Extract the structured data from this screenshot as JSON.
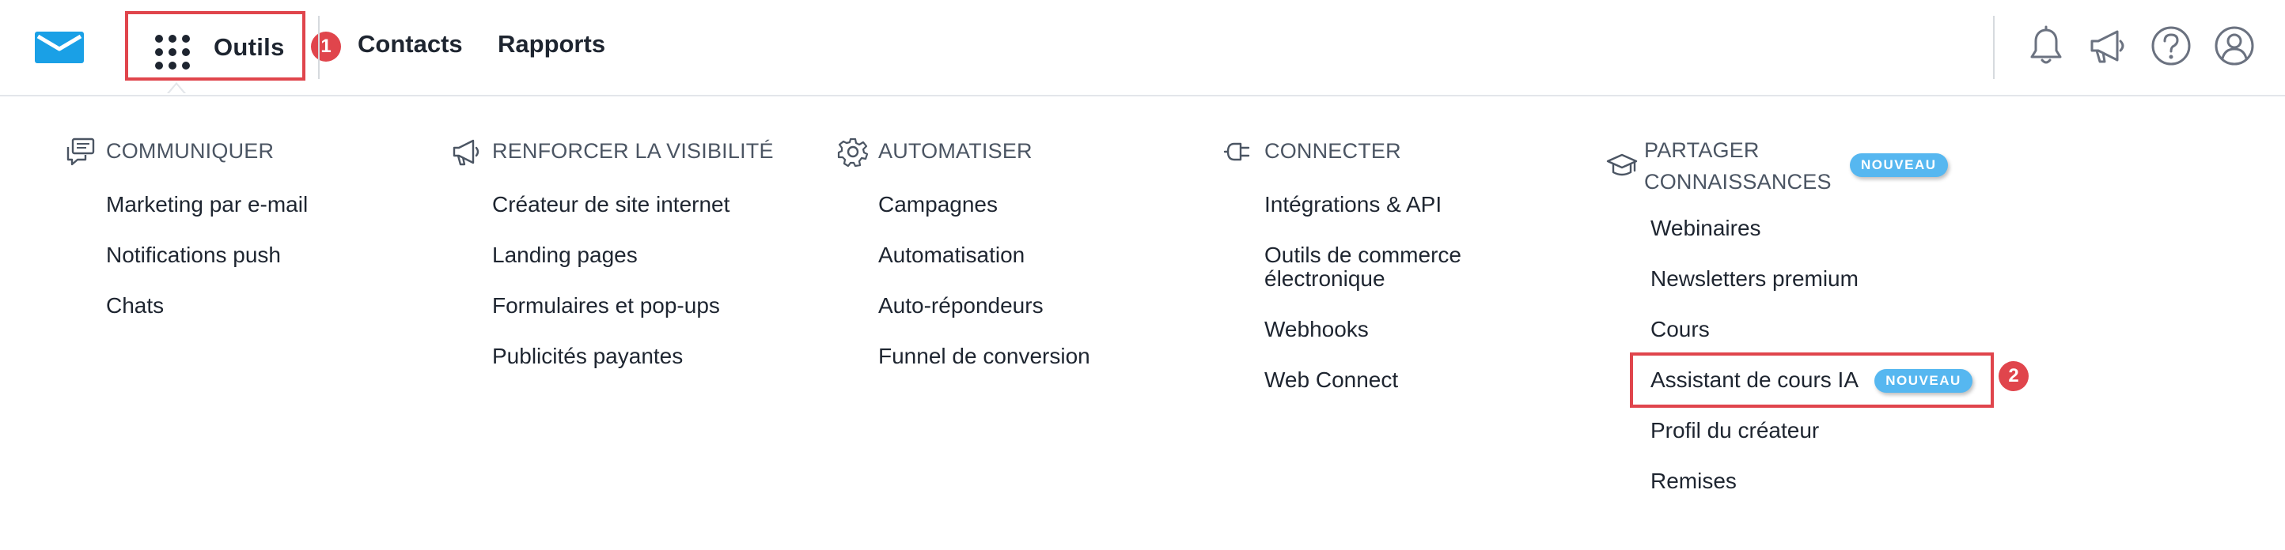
{
  "nav": {
    "tools_label": "Outils",
    "tools_step": "1",
    "links": [
      "Contacts",
      "Rapports"
    ],
    "icons": [
      "bell-icon",
      "megaphone-icon",
      "help-icon",
      "account-icon"
    ]
  },
  "menu": {
    "badge_new": "NOUVEAU",
    "columns": [
      {
        "title": "COMMUNIQUER",
        "icon": "chat-icon",
        "items": [
          "Marketing par e-mail",
          "Notifications push",
          "Chats"
        ]
      },
      {
        "title": "RENFORCER LA VISIBILITÉ",
        "icon": "megaphone-icon",
        "items": [
          "Créateur de site internet",
          "Landing pages",
          "Formulaires et pop-ups",
          "Publicités payantes"
        ]
      },
      {
        "title": "AUTOMATISER",
        "icon": "gear-icon",
        "items": [
          "Campagnes",
          "Automatisation",
          "Auto-répondeurs",
          "Funnel de conversion"
        ]
      },
      {
        "title": "CONNECTER",
        "icon": "plug-icon",
        "items": [
          "Intégrations & API",
          "Outils de commerce",
          "électronique",
          "Webhooks",
          "Web Connect"
        ]
      },
      {
        "title_line1": "PARTAGER",
        "title_line2": "CONNAISSANCES",
        "icon": "graduation-cap-icon",
        "items": [
          "Webinaires",
          "Newsletters premium",
          "Cours",
          "Assistant de cours IA",
          "Profil du créateur",
          "Remises"
        ],
        "highlight_step": "2"
      }
    ]
  },
  "colors": {
    "accent_red": "#e0454c",
    "badge_blue": "#56b7f0",
    "logo_blue": "#1aa0e6",
    "text_dark": "#1e2530"
  }
}
